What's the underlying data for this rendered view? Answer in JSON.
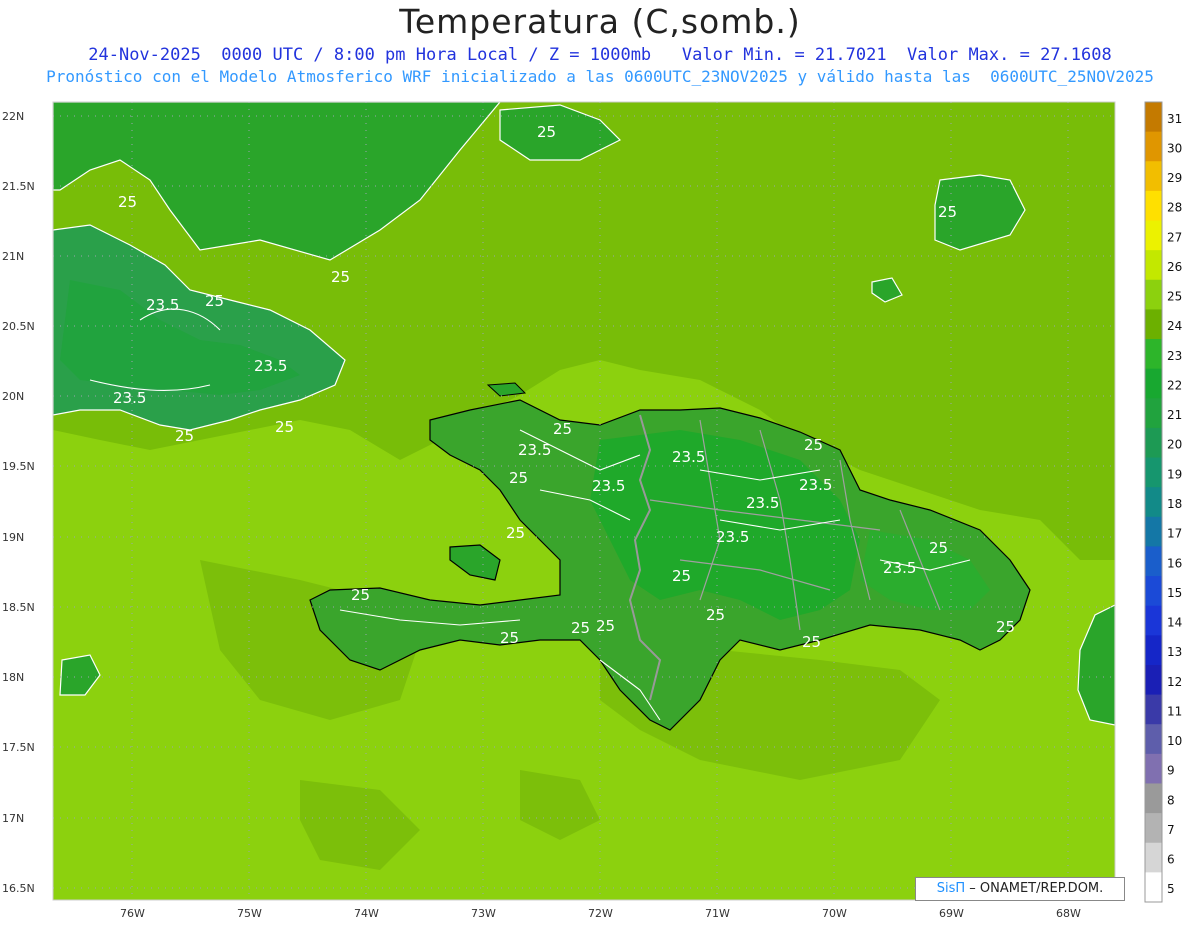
{
  "header": {
    "title": "Temperatura (C,somb.)",
    "subtitle_1": "24-Nov-2025  0000 UTC / 8:00 pm Hora Local / Z = 1000mb   Valor Min. = 21.7021  Valor Max. = 27.1608",
    "subtitle_2": "Pronóstico con el Modelo Atmosferico WRF inicializado a las 0600UTC_23NOV2025 y válido hasta las  0600UTC_25NOV2025"
  },
  "map": {
    "lat_labels": [
      "22N",
      "21.5N",
      "21N",
      "20.5N",
      "20N",
      "19.5N",
      "19N",
      "18.5N",
      "18N",
      "17.5N",
      "17N",
      "16.5N"
    ],
    "lon_labels": [
      "76W",
      "75W",
      "74W",
      "73W",
      "72W",
      "71W",
      "70W",
      "69W",
      "68W"
    ],
    "contour_labels": [
      "25",
      "25",
      "25",
      "25",
      "25",
      "23.5",
      "25",
      "23.5",
      "23.5",
      "25",
      "25",
      "25",
      "23.5",
      "25",
      "23.5",
      "25",
      "23.5",
      "23.5",
      "25",
      "23.5",
      "23.5",
      "25",
      "23.5",
      "25",
      "25",
      "25",
      "25",
      "25",
      "25",
      "25"
    ],
    "colors": {
      "sea_warm": "#8cd10e",
      "sea_mid": "#7cbf0a",
      "land_cool": "#1faa2a",
      "land_mid": "#3aa52c",
      "coast": "#000000",
      "border": "#999999"
    }
  },
  "colorbar": {
    "labels": [
      "31",
      "30",
      "29",
      "28",
      "27",
      "26",
      "25",
      "24",
      "23",
      "22",
      "21",
      "20",
      "19",
      "18",
      "17",
      "16",
      "15",
      "14",
      "13",
      "12",
      "11",
      "10",
      "9",
      "8",
      "7",
      "6",
      "5"
    ],
    "colors": [
      "#c47a00",
      "#e09600",
      "#f2be00",
      "#ffe000",
      "#ecf200",
      "#c3e800",
      "#8cd10e",
      "#6cb000",
      "#2db52a",
      "#18a830",
      "#21a33e",
      "#1d9a54",
      "#16966e",
      "#128a88",
      "#1477a6",
      "#1a5ecb",
      "#1b4ad7",
      "#1a36d8",
      "#1526c8",
      "#1a1fb5",
      "#3a3aa8",
      "#5e5eab",
      "#8070b0",
      "#9a9a9a",
      "#b3b3b3",
      "#d6d6d6",
      "#ffffff"
    ]
  },
  "credit": {
    "brand": "SisΠ",
    "text": " – ONAMET/REP.DOM."
  }
}
